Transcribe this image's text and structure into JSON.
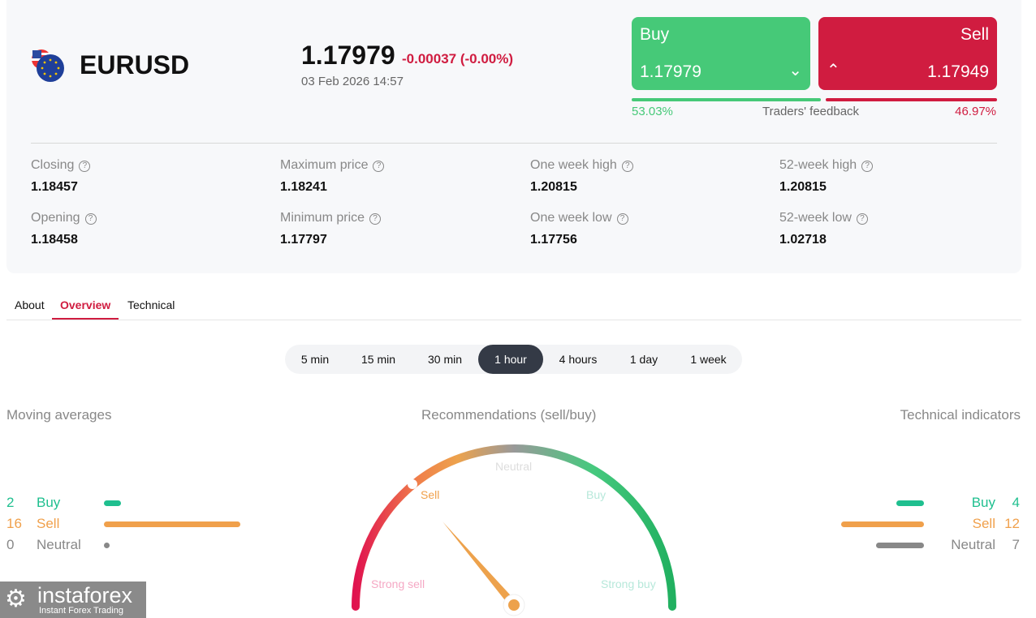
{
  "instrument": {
    "symbol": "EURUSD",
    "price": "1.17979",
    "change": "-0.00037 (-0.00%)",
    "datetime": "03 Feb 2026 14:57"
  },
  "trade": {
    "buy_label": "Buy",
    "buy_price": "1.17979",
    "sell_label": "Sell",
    "sell_price": "1.17949",
    "buy_pct": "53.03%",
    "sell_pct": "46.97%",
    "buy_fraction": 0.5303,
    "feedback_label": "Traders' feedback"
  },
  "stats": [
    {
      "label": "Closing",
      "value": "1.18457"
    },
    {
      "label": "Maximum price",
      "value": "1.18241"
    },
    {
      "label": "One week high",
      "value": "1.20815"
    },
    {
      "label": "52-week high",
      "value": "1.20815"
    },
    {
      "label": "Opening",
      "value": "1.18458"
    },
    {
      "label": "Minimum price",
      "value": "1.17797"
    },
    {
      "label": "One week low",
      "value": "1.17756"
    },
    {
      "label": "52-week low",
      "value": "1.02718"
    }
  ],
  "tabs": [
    "About",
    "Overview",
    "Technical"
  ],
  "periods": [
    "5 min",
    "15 min",
    "30 min",
    "1 hour",
    "4 hours",
    "1 day",
    "1 week"
  ],
  "sections": {
    "moving": "Moving averages",
    "recommend": "Recommendations (sell/buy)",
    "technical": "Technical indicators"
  },
  "moving_averages": [
    {
      "count": "2",
      "label": "Buy",
      "color": "#1fbf8f"
    },
    {
      "count": "16",
      "label": "Sell",
      "color": "#f0a04b"
    },
    {
      "count": "0",
      "label": "Neutral",
      "color": "#888888"
    }
  ],
  "technical_indicators": [
    {
      "count": "4",
      "label": "Buy",
      "color": "#1fbf8f"
    },
    {
      "count": "12",
      "label": "Sell",
      "color": "#f0a04b"
    },
    {
      "count": "7",
      "label": "Neutral",
      "color": "#888888"
    }
  ],
  "gauge": {
    "labels": {
      "strong_sell": "Strong sell",
      "sell": "Sell",
      "neutral": "Neutral",
      "buy": "Buy",
      "strong_buy": "Strong buy"
    },
    "needle_value": -0.45,
    "summary": "Sell"
  },
  "logo": {
    "name": "instaforex",
    "tagline": "Instant Forex Trading"
  }
}
